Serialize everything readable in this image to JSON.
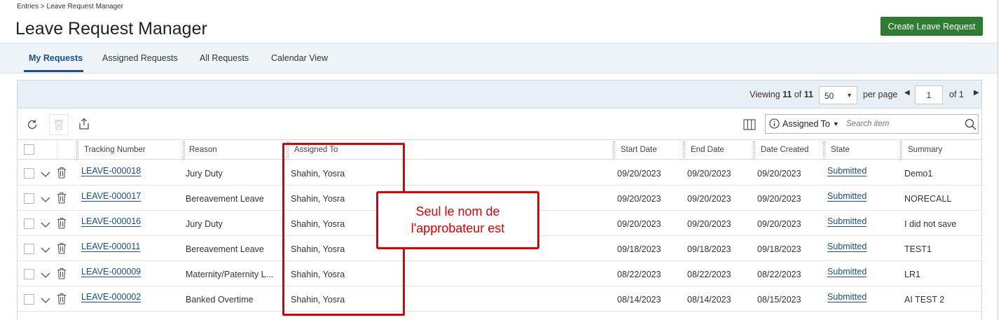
{
  "breadcrumb": "Entries > Leave Request Manager",
  "page_title": "Leave Request Manager",
  "create_button_label": "Create Leave Request",
  "tabs": [
    {
      "label": "My Requests",
      "active": true
    },
    {
      "label": "Assigned Requests",
      "active": false
    },
    {
      "label": "All Requests",
      "active": false
    },
    {
      "label": "Calendar View",
      "active": false
    }
  ],
  "pagination": {
    "viewing_label": "Viewing",
    "viewing_count": "11",
    "of_label": "of",
    "total": "11",
    "per_page_value": "50",
    "per_page_label": "per page",
    "current_page": "1",
    "page_of_label": "of 1"
  },
  "search": {
    "field_label": "Assigned To",
    "placeholder": "Search item"
  },
  "columns": {
    "tracking": "Tracking Number",
    "reason": "Reason",
    "assigned": "Assigned To",
    "start": "Start Date",
    "end": "End Date",
    "created": "Date Created",
    "state": "State",
    "summary": "Summary"
  },
  "rows": [
    {
      "tracking": "LEAVE-000018",
      "reason": "Jury Duty",
      "assigned": "Shahin, Yosra",
      "start": "09/20/2023",
      "end": "09/20/2023",
      "created": "09/20/2023",
      "state": "Submitted",
      "summary": "Demo1"
    },
    {
      "tracking": "LEAVE-000017",
      "reason": "Bereavement Leave",
      "assigned": "Shahin, Yosra",
      "start": "09/20/2023",
      "end": "09/20/2023",
      "created": "09/20/2023",
      "state": "Submitted",
      "summary": "NORECALL"
    },
    {
      "tracking": "LEAVE-000016",
      "reason": "Jury Duty",
      "assigned": "Shahin, Yosra",
      "start": "09/20/2023",
      "end": "09/20/2023",
      "created": "09/20/2023",
      "state": "Submitted",
      "summary": "I did not save"
    },
    {
      "tracking": "LEAVE-000011",
      "reason": "Bereavement Leave",
      "assigned": "Shahin, Yosra",
      "start": "09/18/2023",
      "end": "09/18/2023",
      "created": "09/18/2023",
      "state": "Submitted",
      "summary": "TEST1"
    },
    {
      "tracking": "LEAVE-000009",
      "reason": "Maternity/Paternity L...",
      "assigned": "Shahin, Yosra",
      "start": "08/22/2023",
      "end": "08/22/2023",
      "created": "08/22/2023",
      "state": "Submitted",
      "summary": "LR1"
    },
    {
      "tracking": "LEAVE-000002",
      "reason": "Banked Overtime",
      "assigned": "Shahin, Yosra",
      "start": "08/14/2023",
      "end": "08/14/2023",
      "created": "08/15/2023",
      "state": "Submitted",
      "summary": "AI TEST 2"
    }
  ],
  "annotation": {
    "line1": "Seul le nom de",
    "line2": "l'approbateur est",
    "color": "#e00000"
  },
  "colors": {
    "accent": "#1a4f8b",
    "create_button": "#2e7d32",
    "tab_bar": "#eef4f8"
  }
}
